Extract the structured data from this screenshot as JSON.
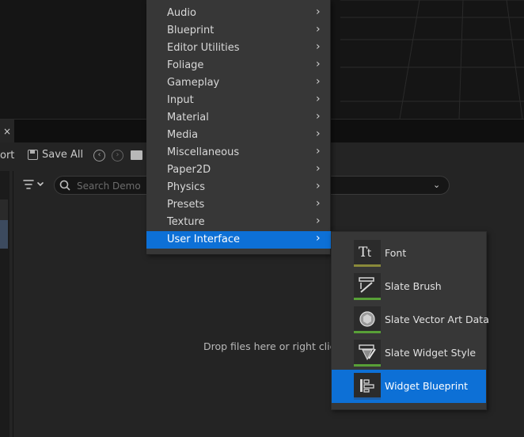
{
  "toolbar": {
    "import_label": "ort",
    "save_all_label": "Save All"
  },
  "tab": {
    "close_glyph": "×"
  },
  "search": {
    "placeholder": "Search Demo"
  },
  "content": {
    "drop_hint": "Drop files here or right click"
  },
  "menu": {
    "items": [
      {
        "label": "Audio"
      },
      {
        "label": "Blueprint"
      },
      {
        "label": "Editor Utilities"
      },
      {
        "label": "Foliage"
      },
      {
        "label": "Gameplay"
      },
      {
        "label": "Input"
      },
      {
        "label": "Material"
      },
      {
        "label": "Media"
      },
      {
        "label": "Miscellaneous"
      },
      {
        "label": "Paper2D"
      },
      {
        "label": "Physics"
      },
      {
        "label": "Presets"
      },
      {
        "label": "Texture"
      },
      {
        "label": "User Interface",
        "active": true
      }
    ],
    "arrow_glyph": "›"
  },
  "submenu": {
    "items": [
      {
        "label": "Font",
        "icon": "font-icon",
        "accent": "#8a8a3a"
      },
      {
        "label": "Slate Brush",
        "icon": "slate-brush-icon",
        "accent": "#58a037"
      },
      {
        "label": "Slate Vector Art Data",
        "icon": "vector-art-icon",
        "accent": "#58a037"
      },
      {
        "label": "Slate Widget Style",
        "icon": "widget-style-icon",
        "accent": "#58a037"
      },
      {
        "label": "Widget Blueprint",
        "icon": "widget-blueprint-icon",
        "accent": "#1d5fa8",
        "active": true
      }
    ]
  },
  "colors": {
    "highlight": "#0d70d6",
    "menu_bg": "#373737",
    "panel_bg": "#242424"
  }
}
